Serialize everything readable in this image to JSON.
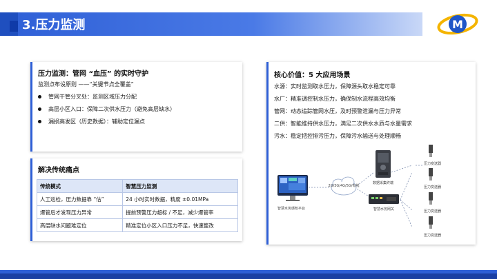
{
  "header": {
    "title": "3.压力监测"
  },
  "left_top": {
    "title": "压力监测：管网 “血压” 的实时守护",
    "subtitle": "监测点布设原则 ——“关键节点全覆盖”",
    "bullets": [
      "管网干管分叉处：监测区域压力分配",
      "高层小区入口：保障二次供水压力（避免高层缺水）",
      "漏损高发区（历史数据）：辅助定位漏点"
    ]
  },
  "left_bottom": {
    "title": "解决传统痛点",
    "table": {
      "headers": [
        "传统模式",
        "智慧压力监测"
      ],
      "rows": [
        [
          "人工巡检，压力数据靠 “估”",
          "24 小时实时数据，精度 ±0.01MPa"
        ],
        [
          "爆管后才发现压力异常",
          "提前预警压力超标 / 不足，减少爆管率"
        ],
        [
          "高层缺水问题难定位",
          "精准定位小区入口压力不足，快速整改"
        ]
      ]
    }
  },
  "right": {
    "title": "核心价值：5 大应用场景",
    "values": [
      "水源：实时监测取水压力，保障源头取水稳定可靠",
      "水厂：精准调控制水压力，确保制水流程高效均衡",
      "管网：动态追踪管网水压，及时预警泄漏与压力异常",
      "二供：智能维持供水压力，满足二次供水水质与水量需求",
      "污水：稳定把控排污压力，保障污水输送与处理顺畅"
    ]
  },
  "diagram": {
    "terminal_label": "数据采集终端",
    "cloud_label": "2G/3G/4G/5G/有线",
    "gateway_label": "智慧水务网关",
    "platform_label": "智慧水务感知平台",
    "sensor_labels": [
      "压力变送器",
      "压力变送器",
      "压力变送器",
      "压力变送器"
    ]
  },
  "colors": {
    "brand_blue": "#2e5fd6",
    "dark_blue": "#1a3fa3"
  },
  "icons": [
    "logo-m-icon",
    "monitor-icon",
    "cloud-icon",
    "terminal-icon",
    "gateway-icon",
    "pressure-transmitter-icon"
  ]
}
